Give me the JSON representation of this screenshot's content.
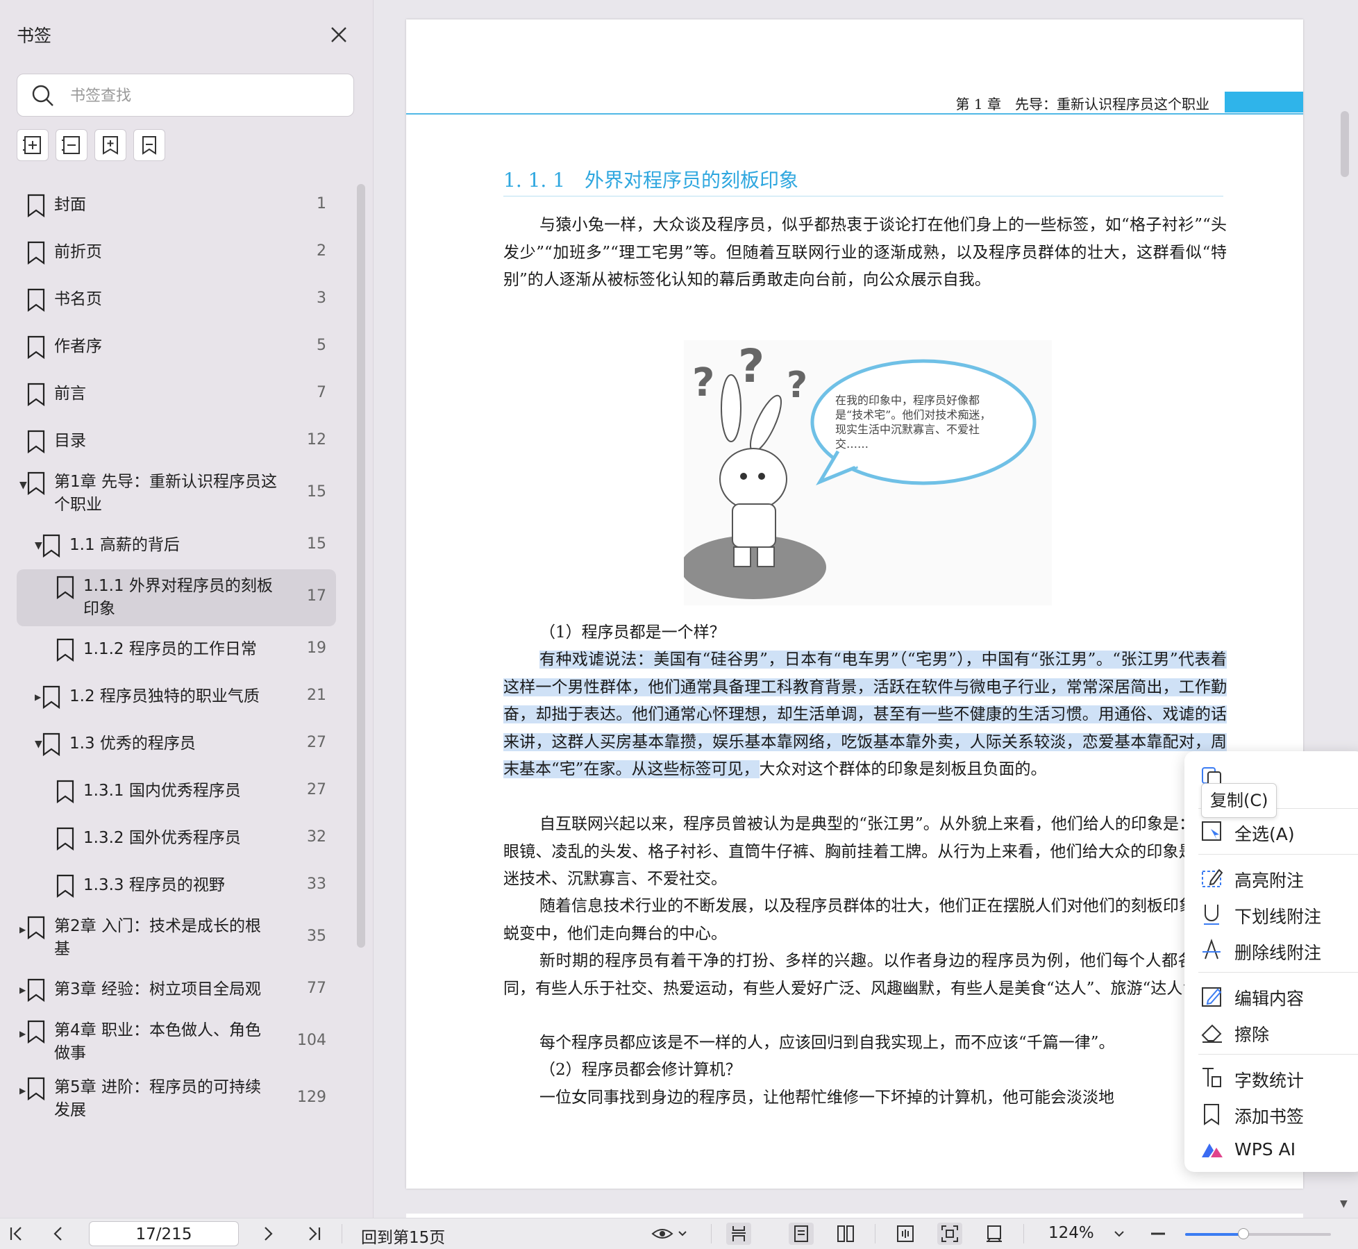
{
  "sidebar": {
    "title": "书签",
    "search_placeholder": "书签查找",
    "toolbar": [
      "add-bookmark",
      "remove-bookmark",
      "insert-bookmark",
      "bookmark-settings"
    ],
    "items": [
      {
        "label": "封面",
        "page": "1",
        "level": 0,
        "caret": "none"
      },
      {
        "label": "前折页",
        "page": "2",
        "level": 0,
        "caret": "none"
      },
      {
        "label": "书名页",
        "page": "3",
        "level": 0,
        "caret": "none"
      },
      {
        "label": "作者序",
        "page": "5",
        "level": 0,
        "caret": "none"
      },
      {
        "label": "前言",
        "page": "7",
        "level": 0,
        "caret": "none"
      },
      {
        "label": "目录",
        "page": "12",
        "level": 0,
        "caret": "none"
      },
      {
        "label": "第1章 先导：重新认识程序员这个职业",
        "line1": "第1章 先导：重新认识程序员这",
        "line2": "个职业",
        "page": "15",
        "level": 0,
        "caret": "open"
      },
      {
        "label": "1.1 高薪的背后",
        "page": "15",
        "level": 1,
        "caret": "open"
      },
      {
        "label": "1.1.1 外界对程序员的刻板印象",
        "line1": "1.1.1 外界对程序员的刻板",
        "line2": "印象",
        "page": "17",
        "level": 2,
        "caret": "none",
        "selected": true
      },
      {
        "label": "1.1.2 程序员的工作日常",
        "page": "19",
        "level": 2,
        "caret": "none"
      },
      {
        "label": "1.2 程序员独特的职业气质",
        "page": "21",
        "level": 1,
        "caret": "closed"
      },
      {
        "label": "1.3 优秀的程序员",
        "page": "27",
        "level": 1,
        "caret": "open"
      },
      {
        "label": "1.3.1 国内优秀程序员",
        "page": "27",
        "level": 2,
        "caret": "none"
      },
      {
        "label": "1.3.2 国外优秀程序员",
        "page": "32",
        "level": 2,
        "caret": "none"
      },
      {
        "label": "1.3.3 程序员的视野",
        "page": "33",
        "level": 2,
        "caret": "none"
      },
      {
        "label": "第2章 入门：技术是成长的根基",
        "line1": "第2章 入门：技术是成长的根",
        "line2": "基",
        "page": "35",
        "level": 0,
        "caret": "closed"
      },
      {
        "label": "第3章 经验：树立项目全局观",
        "page": "77",
        "level": 0,
        "caret": "closed"
      },
      {
        "label": "第4章 职业：本色做人、角色做事",
        "line1": "第4章 职业：本色做人、角色",
        "line2": "做事",
        "page": "104",
        "level": 0,
        "caret": "closed"
      },
      {
        "label": "第5章 进阶：程序员的可持续发展",
        "line1": "第5章 进阶：程序员的可持续",
        "line2": "发展",
        "page": "129",
        "level": 0,
        "caret": "closed"
      }
    ]
  },
  "document": {
    "running_header": "第 1 章　先导：重新认识程序员这个职业",
    "section_title": "1. 1. 1　外界对程序员的刻板印象",
    "intro_paragraph": "与猿小兔一样，大众谈及程序员，似乎都热衷于谈论打在他们身上的一些标签，如“格子衬衫”“头发少”“加班多”“理工宅男”等。但随着互联网行业的逐渐成熟，以及程序员群体的壮大，这群看似“特别”的人逐渐从被标签化认知的幕后勇敢走向台前，向公众展示自我。",
    "figure": {
      "bubble_text": "在我的印象中，程序员好像都是“技术宅”。他们对技术痴迷，现实生活中沉默寡言、不爱社交……",
      "question_marks": "? ? ?"
    },
    "q1": "（1）程序员都是一个样？",
    "highlighted_text": "有种戏谑说法：美国有“硅谷男”，日本有“电车男”（“宅男”），中国有“张江男”。“张江男”代表着这样一个男性群体，他们通常具备理工科教育背景，活跃在软件与微电子行业，常常深居简出，工作勤奋，却拙于表达。他们通常心怀理想，却生活单调，甚至有一些不健康的生活习惯。用通俗、戏谑的话来讲，这群人买房基本靠攒，娱乐基本靠网络，吃饭基本靠外卖，人际关系较淡，恋爱基本靠配对，周末基本“宅”在家。从这些标签可见，",
    "after_highlight": "大众对这个群体的印象是刻板且负面的。",
    "para3": "自互联网兴起以来，程序员曾被认为是典型的“张江男”。从外貌上来看，他们给人的印象是：黑框眼镜、凌乱的头发、格子衬衫、直筒牛仔裤、胸前挂着工牌。从行为上来看，他们给大众的印象是：痴迷技术、沉默寡言、不爱社交。",
    "para4": "随着信息技术行业的不断发展，以及程序员群体的壮大，他们正在摆脱人们对他们的刻板印象。在蜕变中，他们走向舞台的中心。",
    "para5": "新时期的程序员有着干净的打扮、多样的兴趣。以作者身边的程序员为例，他们每个人都各不相同，有些人乐于社交、热爱运动，有些人爱好广泛、风趣幽默，有些人是美食“达人”、旅游“达人”。",
    "para6": "每个程序员都应该是不一样的人，应该回归到自我实现上，而不应该“千篇一律”。",
    "q2": "（2）程序员都会修计算机？",
    "para7": "一位女同事找到身边的程序员，让他帮忙维修一下坏掉的计算机，他可能会淡淡地"
  },
  "context_menu": {
    "tooltip": "复制(C)",
    "items": [
      {
        "label": "全选(A)",
        "icon": "select-all-icon"
      },
      {
        "label": "高亮附注",
        "icon": "highlight-note-icon"
      },
      {
        "label": "下划线附注",
        "icon": "underline-note-icon"
      },
      {
        "label": "删除线附注",
        "icon": "strikethrough-note-icon"
      },
      {
        "label": "编辑内容",
        "icon": "edit-content-icon"
      },
      {
        "label": "擦除",
        "icon": "eraser-icon"
      },
      {
        "label": "字数统计",
        "icon": "word-count-icon"
      },
      {
        "label": "添加书签",
        "icon": "add-bookmark-icon"
      },
      {
        "label": "WPS AI",
        "icon": "wps-ai-icon"
      }
    ]
  },
  "statusbar": {
    "page_indicator": "17/215",
    "back_to_page": "回到第15页",
    "zoom": "124%",
    "zoom_fraction": 0.4
  },
  "colors": {
    "accent_blue": "#2fa7df",
    "selection_highlight": "#cfe1f6",
    "sidebar_bg": "#e8e4ea",
    "selected_row": "#d6d2d9"
  }
}
